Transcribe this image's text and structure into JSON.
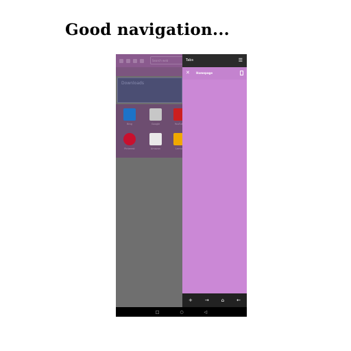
{
  "caption": "Good navigation...",
  "background_browser": {
    "search_placeholder": "Search web",
    "download_label": "Downloads",
    "tiles": [
      {
        "label": "Bing",
        "icon": "bing-icon",
        "color": "#1d73c8"
      },
      {
        "label": "Google",
        "icon": "google-icon",
        "color": "#c7c7c7"
      },
      {
        "label": "YouTube",
        "icon": "youtube-icon",
        "color": "#cc1f1f"
      },
      {
        "label": "Pinterest",
        "icon": "pinterest-icon",
        "color": "#c8102e"
      },
      {
        "label": "Amazon",
        "icon": "amazon-icon",
        "color": "#e9e9e9"
      },
      {
        "label": "Lemon",
        "icon": "app-icon",
        "color": "#f0a800"
      }
    ]
  },
  "tabs_panel": {
    "title": "Tabs",
    "menu_icon": "hamburger-icon",
    "tab": {
      "close_icon": "close-icon",
      "name": "Homepage",
      "page_icon": "document-icon"
    },
    "accent_color": "#cb88d6"
  },
  "bottom_bar": {
    "add": "+",
    "forward": "→",
    "home": "⌂",
    "back": "←"
  },
  "system_nav": {
    "recent": "□",
    "home": "○",
    "back": "◁"
  }
}
